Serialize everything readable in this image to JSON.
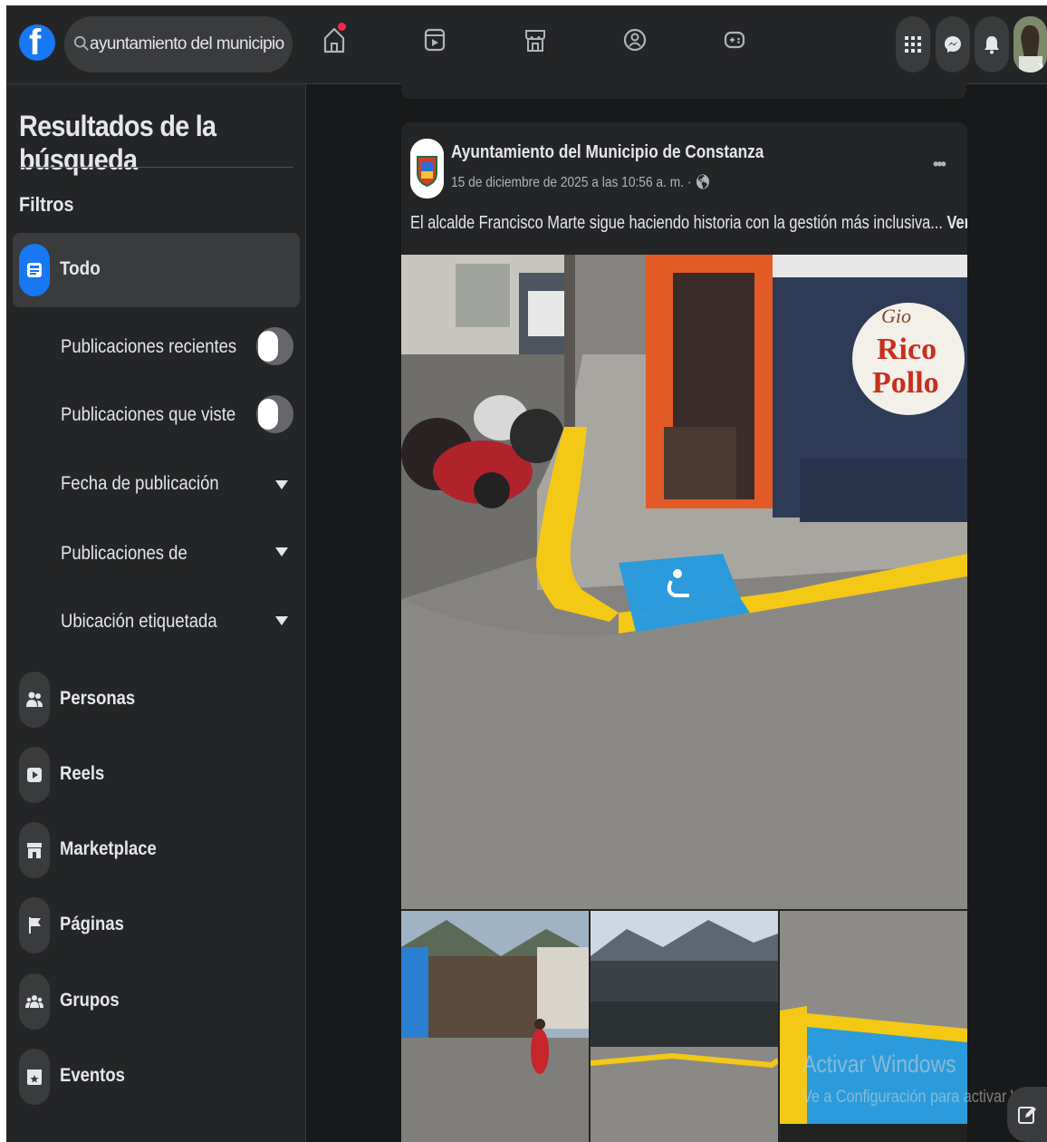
{
  "search": {
    "value": "ayuntamiento del municipio de cor"
  },
  "sidebar": {
    "title": "Resultados de la búsqueda",
    "filters_heading": "Filtros",
    "selected_filter": "Todo",
    "toggles": [
      {
        "label": "Publicaciones recientes",
        "on": false
      },
      {
        "label": "Publicaciones que viste",
        "on": false
      }
    ],
    "dropdowns": [
      {
        "label": "Fecha de publicación"
      },
      {
        "label": "Publicaciones de"
      },
      {
        "label": "Ubicación etiquetada"
      }
    ],
    "categories": [
      {
        "label": "Personas",
        "icon": "people-icon"
      },
      {
        "label": "Reels",
        "icon": "reels-icon"
      },
      {
        "label": "Marketplace",
        "icon": "marketplace-icon"
      },
      {
        "label": "Páginas",
        "icon": "flag-icon"
      },
      {
        "label": "Grupos",
        "icon": "groups-icon"
      },
      {
        "label": "Eventos",
        "icon": "calendar-icon"
      }
    ]
  },
  "post": {
    "author": "Ayuntamiento del Municipio de Constanza",
    "date": "15 de diciembre de 2025 a las 10:56 a. m. ·",
    "text": "El alcalde Francisco Marte sigue haciendo historia con la gestión más inclusiva...",
    "see_more": "Ver más",
    "more_menu": "•••",
    "sign_text": [
      "Gio",
      "Rico",
      "Pollo"
    ]
  },
  "watermark": {
    "line1": "Activar Windows",
    "line2": "Ve a Configuración para activar Windows."
  },
  "colors": {
    "accent": "#1877f2",
    "notification": "#f02849",
    "bg": "#18191a",
    "card": "#242526"
  }
}
